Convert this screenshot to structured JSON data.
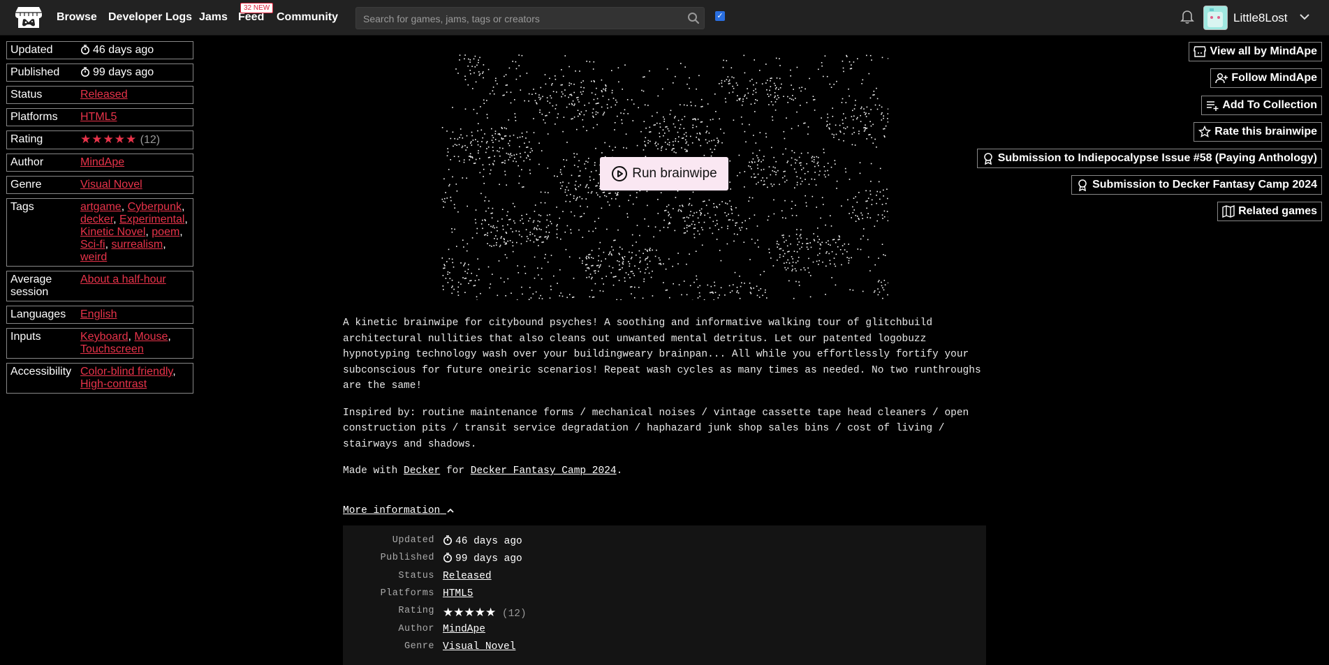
{
  "nav": {
    "items": [
      "Browse",
      "Developer Logs",
      "Jams",
      "Feed",
      "Community"
    ],
    "feed_badge": "32 NEW",
    "search_placeholder": "Search for games, jams, tags or creators",
    "username": "Little8Lost"
  },
  "colors": {
    "accent": "#e8334a",
    "run_button_bg": "#fae7f2",
    "topbar": "#222222"
  },
  "info": {
    "updated_label": "Updated",
    "updated_value": "46 days ago",
    "published_label": "Published",
    "published_value": "99 days ago",
    "status_label": "Status",
    "status_value": "Released",
    "platforms_label": "Platforms",
    "platforms_value": "HTML5",
    "rating_label": "Rating",
    "rating_stars": 5,
    "rating_count": "(12)",
    "author_label": "Author",
    "author_value": "MindApe",
    "genre_label": "Genre",
    "genre_value": "Visual Novel",
    "tags_label": "Tags",
    "tags": [
      "artgame",
      "Cyberpunk",
      "decker",
      "Experimental",
      "Kinetic Novel",
      "poem",
      "Sci-fi",
      "surrealism",
      "weird"
    ],
    "session_label": "Average session",
    "session_value": "About a half-hour",
    "languages_label": "Languages",
    "languages_value": "English",
    "inputs_label": "Inputs",
    "inputs": [
      "Keyboard",
      "Mouse",
      "Touchscreen"
    ],
    "accessibility_label": "Accessibility",
    "accessibility": [
      "Color-blind friendly",
      "High-contrast"
    ]
  },
  "actions": {
    "view_all": "View all by MindApe",
    "follow": "Follow MindApe",
    "add_collection": "Add To Collection",
    "rate": "Rate this brainwipe",
    "submission1": "Submission to Indiepocalypse Issue #58 (Paying Anthology)",
    "submission2": "Submission to Decker Fantasy Camp 2024",
    "related": "Related games"
  },
  "game": {
    "run_label": "Run brainwipe"
  },
  "description": {
    "p1": "A kinetic brainwipe for citybound psyches! A soothing and informative walking tour of glitchbuild architectural nullities that also cleans out unwanted mental detritus. Let our patented logobuzz hypnotyping technology wash over your buildingweary brainpan... All while you effortlessly fortify your subconscious for future oneiric scenarios! Repeat wash cycles as many times as needed. No two runthroughs are the same!",
    "p2": "Inspired by: routine maintenance forms / mechanical noises / vintage cassette tape head cleaners / open construction pits / transit service degradation / haphazard junk shop sales bins / cost of living / stairways and shadows.",
    "made_with_prefix": "Made with",
    "made_with_tool": "Decker",
    "made_with_for": "for",
    "made_with_jam": "Decker Fantasy Camp 2024",
    "made_with_suffix": "."
  },
  "more_info_label": "More information"
}
